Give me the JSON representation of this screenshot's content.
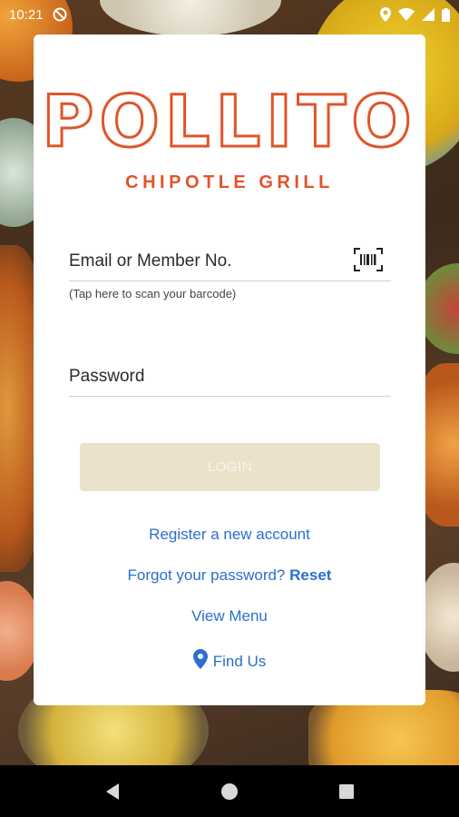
{
  "status_bar": {
    "time": "10:21",
    "icons": [
      "do-not-disturb-icon",
      "location-icon",
      "wifi-icon",
      "signal-icon",
      "battery-icon"
    ]
  },
  "logo": {
    "main": "POLLITO",
    "sub": "CHIPOTLE GRILL",
    "color": "#e2542a"
  },
  "form": {
    "email_placeholder": "Email or Member No.",
    "barcode_hint": "(Tap here to scan your barcode)",
    "password_placeholder": "Password",
    "login_label": "LOGIN"
  },
  "links": {
    "register": "Register a new account",
    "forgot_prefix": "Forgot your password?",
    "reset": "Reset",
    "view_menu": "View Menu",
    "find_us": "Find Us",
    "color": "#2b6fcf"
  },
  "nav": {
    "buttons": [
      "back-icon",
      "home-icon",
      "recents-icon"
    ]
  }
}
